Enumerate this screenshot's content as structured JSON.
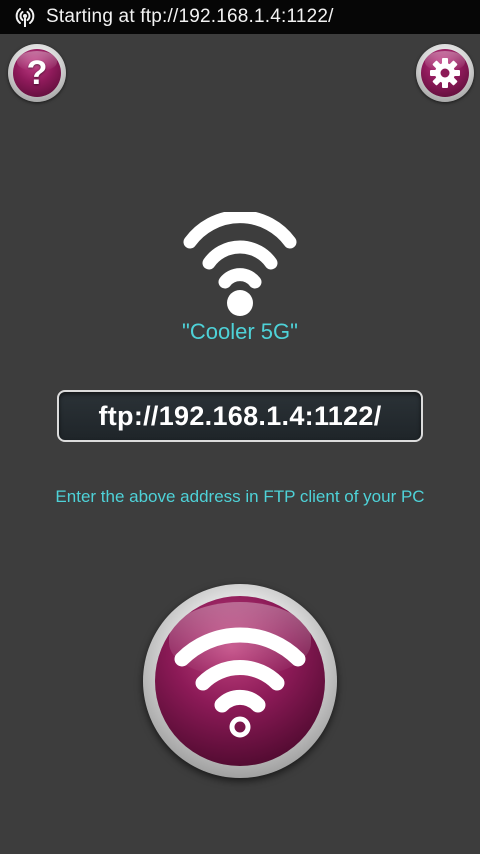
{
  "status_bar": {
    "icon": "wifi-hotspot-icon",
    "text": "Starting at ftp://192.168.1.4:1122/"
  },
  "toolbar": {
    "help_label": "?",
    "help_icon": "help-icon",
    "settings_icon": "gear-icon"
  },
  "network": {
    "icon": "wifi-icon",
    "name": "\"Cooler 5G\""
  },
  "server": {
    "address": "ftp://192.168.1.4:1122/",
    "hint": "Enter the above address in FTP client of your PC"
  },
  "toggle_button": {
    "icon": "wifi-icon"
  },
  "colors": {
    "background": "#3d3d3d",
    "accent_cyan": "#4ed2d8",
    "button_purple": "#8c1a57",
    "status_bar": "#060606"
  }
}
